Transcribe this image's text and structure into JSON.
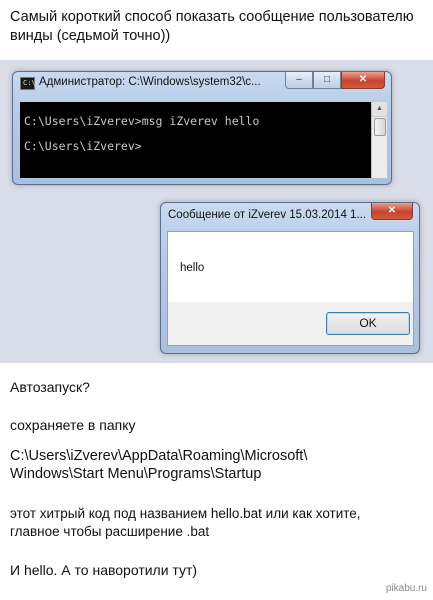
{
  "caption": {
    "top": "Самый короткий способ показать сообщение пользователю винды (седьмой точно))",
    "autostart": "Автозапуск?",
    "save_to": "сохраняете в папку",
    "path_line1": "C:\\Users\\iZverev\\AppData\\Roaming\\Microsoft\\",
    "path_line2": "Windows\\Start Menu\\Programs\\Startup",
    "code_line1": "этот хитрый код под названием hello.bat или как хотите,",
    "code_line2": "главное чтобы расширение .bat",
    "final": "И hello. А то наворотили тут)"
  },
  "cmd_window": {
    "title": "Администратор: C:\\Windows\\system32\\c...",
    "lines": [
      "C:\\Users\\iZverev>msg iZverev hello",
      "C:\\Users\\iZverev>"
    ],
    "icon": "cmd-icon"
  },
  "message_box": {
    "title": "Сообщение от iZverev 15.03.2014 1...",
    "text": "hello",
    "ok_label": "OK"
  },
  "window_controls": {
    "minimize": "–",
    "maximize": "□",
    "close": "✕"
  },
  "watermark": "pikabu.ru"
}
